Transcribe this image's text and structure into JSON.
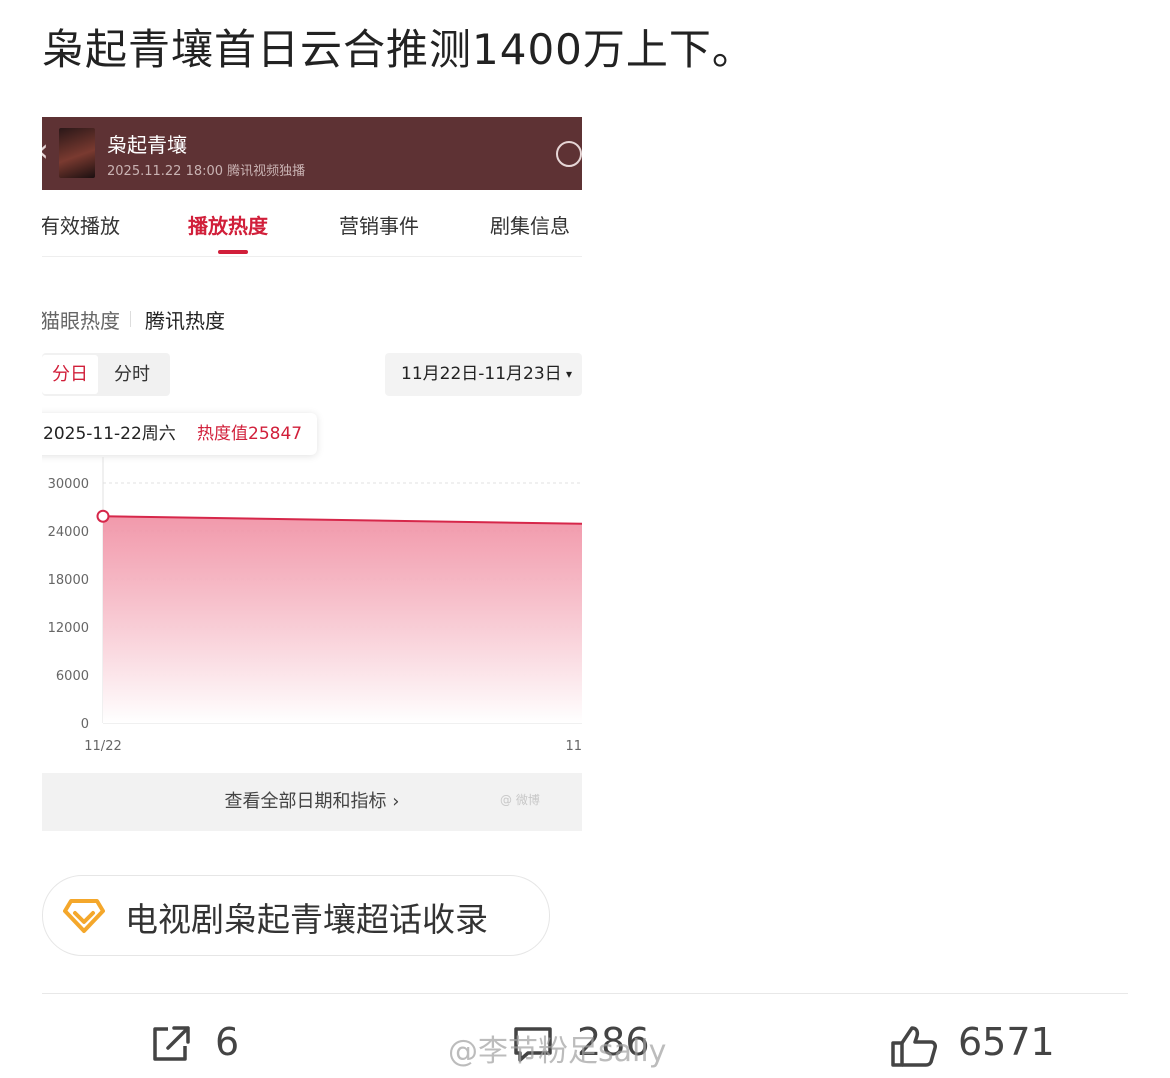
{
  "post": {
    "text": "枭起青壤首日云合推测1400万上下。"
  },
  "screenshot": {
    "header": {
      "back_icon": "chevron-left-icon",
      "title": "枭起青壤",
      "subtitle": "2025.11.22 18:00 腾讯视频独播",
      "share_icon": "share-icon"
    },
    "tabs": [
      {
        "label": "有效播放",
        "active": false
      },
      {
        "label": "播放热度",
        "active": true
      },
      {
        "label": "营销事件",
        "active": false
      },
      {
        "label": "剧集信息",
        "active": false
      }
    ],
    "sources": [
      "猫眼热度",
      "腾讯热度"
    ],
    "segment": {
      "day": "分日",
      "hour": "分时"
    },
    "date_range": "11月22日-11月23日",
    "date_caret": "▾",
    "tooltip": {
      "date": "2025-11-22周六",
      "label": "热度值25847"
    },
    "view_more": "查看全部日期和指标 ›",
    "corner_watermark": "@ 微博"
  },
  "chart_data": {
    "type": "area",
    "x": [
      "11/22",
      "11"
    ],
    "series": [
      {
        "values": [
          25847,
          24900
        ]
      }
    ],
    "ylim": [
      0,
      30000
    ],
    "yticks": [
      "30000",
      "24000",
      "18000",
      "12000",
      "6000",
      "0"
    ],
    "xticks": [
      "11/22",
      "11"
    ],
    "grid": true,
    "colors": {
      "line": "#d6274a",
      "fill_top": "#f08ea2",
      "fill_bottom": "#ffffff"
    }
  },
  "topic": {
    "icon": "diamond-icon",
    "label": "电视剧枭起青壤超话收录"
  },
  "actions": {
    "share_count": "6",
    "comment_count": "286",
    "like_count": "6571"
  },
  "watermark": "@李节粉足sally",
  "colors": {
    "accent": "#d11f3a",
    "header_bg": "#5e3234",
    "topic_icon": "#f4a72b"
  }
}
